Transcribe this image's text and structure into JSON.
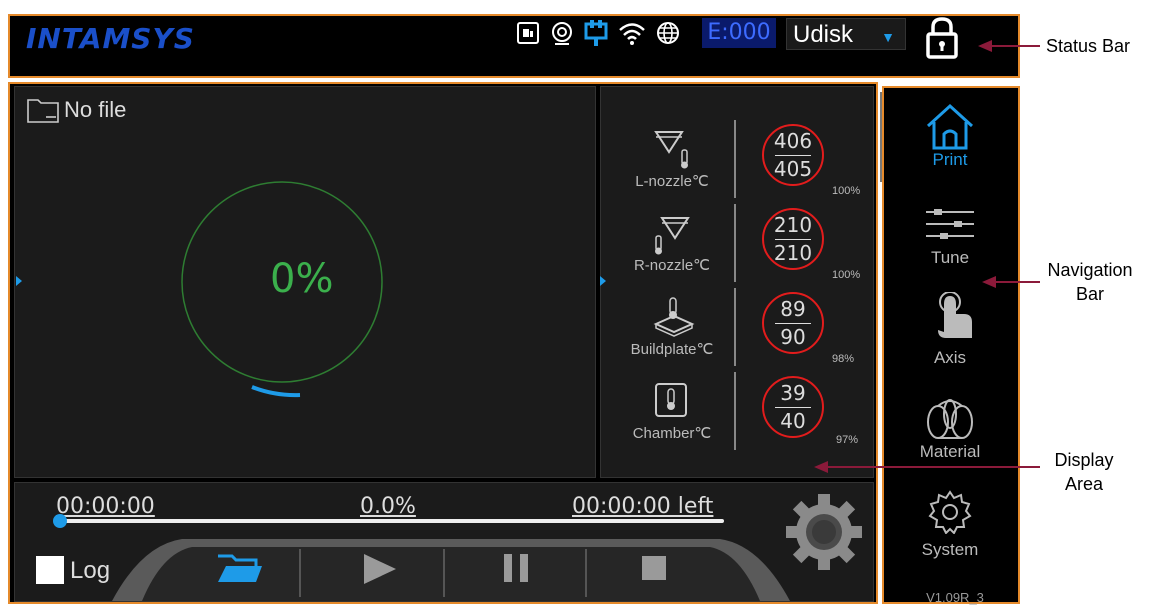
{
  "status_bar": {
    "logo": "INTAMSYS",
    "error_code": "E:000",
    "storage_select": "Udisk",
    "icons": [
      "sd-card-icon",
      "camera-icon",
      "network-port-icon",
      "wifi-icon",
      "globe-icon",
      "lock-icon"
    ]
  },
  "display": {
    "file_label": "No file",
    "progress_percent": "0%"
  },
  "temperatures": [
    {
      "label": "L-nozzle℃",
      "current": "406",
      "target": "405",
      "power": "100%"
    },
    {
      "label": "R-nozzle℃",
      "current": "210",
      "target": "210",
      "power": "100%"
    },
    {
      "label": "Buildplate℃",
      "current": "89",
      "target": "90",
      "power": "98%"
    },
    {
      "label": "Chamber℃",
      "current": "39",
      "target": "40",
      "power": "97%"
    }
  ],
  "controls": {
    "elapsed": "00:00:00",
    "progress": "0.0%",
    "remaining": "00:00:00 left",
    "log_label": "Log",
    "progress_value": 0.0
  },
  "navigation": {
    "items": [
      {
        "label": "Print",
        "active": true
      },
      {
        "label": "Tune",
        "active": false
      },
      {
        "label": "Axis",
        "active": false
      },
      {
        "label": "Material",
        "active": false
      },
      {
        "label": "System",
        "active": false
      }
    ],
    "version": "V1.09R_3"
  },
  "annotations": {
    "status_bar": "Status Bar",
    "navigation_bar": "Navigation Bar",
    "display_area": "Display Area"
  },
  "colors": {
    "accent_orange": "#e58a2b",
    "active_blue": "#1e9be8",
    "temp_ring_red": "#e21c1c",
    "progress_green": "#3bb04c",
    "arrow_maroon": "#8b1a3a"
  }
}
